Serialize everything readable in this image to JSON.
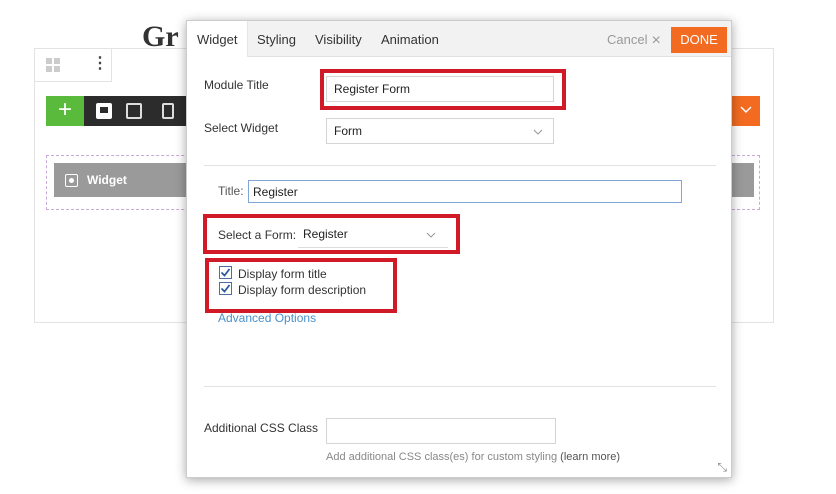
{
  "background": {
    "title_fragment": "Gr",
    "widget_label": "Widget",
    "plus_glyph": "+",
    "chevron_glyph": "⌄"
  },
  "modal": {
    "tabs": [
      "Widget",
      "Styling",
      "Visibility",
      "Animation"
    ],
    "cancel_label": "Cancel",
    "cancel_icon": "×",
    "done_label": "DONE",
    "module_title": {
      "label": "Module Title",
      "value": "Register Form"
    },
    "select_widget": {
      "label": "Select Widget",
      "value": "Form"
    },
    "title_field": {
      "label": "Title:",
      "value": "Register"
    },
    "select_form": {
      "label": "Select a Form:",
      "value": "Register"
    },
    "checkboxes": [
      {
        "label": "Display form title",
        "checked": true
      },
      {
        "label": "Display form description",
        "checked": true
      }
    ],
    "advanced_options": "Advanced Options",
    "additional_css": {
      "label": "Additional CSS Class",
      "value": "",
      "help": "Add additional CSS class(es) for custom styling",
      "learn_more": "(learn more)"
    },
    "resize_glyph": "⤡"
  },
  "colors": {
    "accent_orange": "#f26b21",
    "add_green": "#5aba3c",
    "highlight_red": "#d11a28",
    "link_blue": "#4a90c9"
  }
}
